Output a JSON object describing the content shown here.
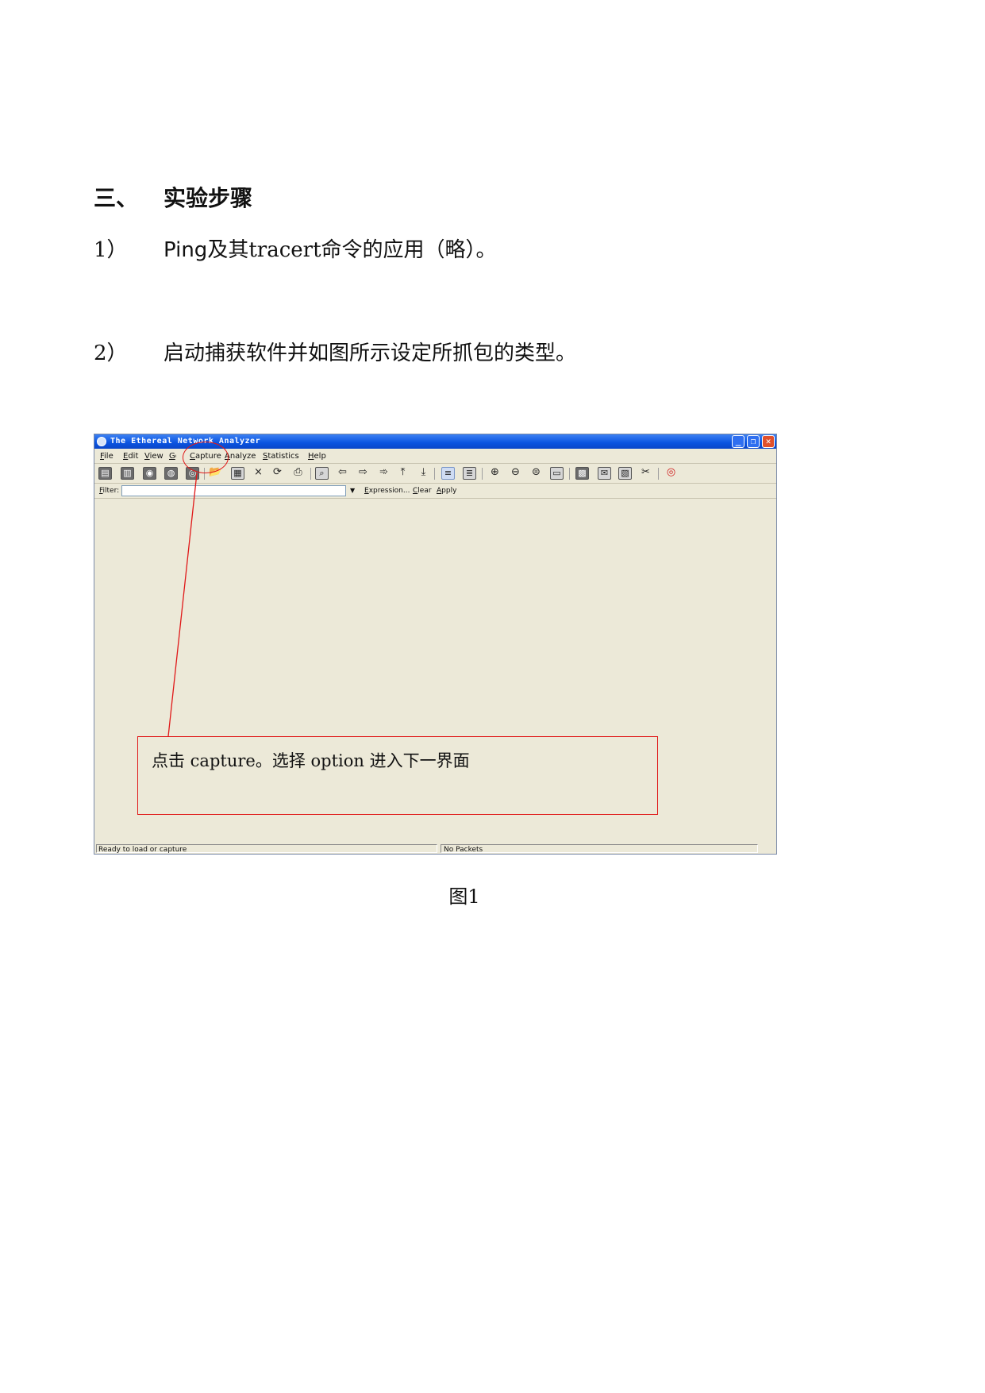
{
  "section_heading": {
    "number": "三、",
    "text": "实验步骤"
  },
  "steps": [
    {
      "number": "1）",
      "prefix": "Ping",
      "text": "及其tracert命令的应用（略）。"
    },
    {
      "number": "2）",
      "text": "启动捕获软件并如图所示设定所抓包的类型。"
    }
  ],
  "screenshot": {
    "window_title": "The Ethereal Network Analyzer",
    "menus": [
      "File",
      "Edit",
      "View",
      "Go",
      "Capture",
      "Analyze",
      "Statistics",
      "Help"
    ],
    "filter_label": "Filter:",
    "filter_value": "",
    "filter_buttons": {
      "expression": "Expression...",
      "clear": "Clear",
      "apply": "Apply"
    },
    "status_left": "Ready to load or capture",
    "status_right": "No Packets",
    "annotation": "点击 capture。选择 option 进入下一界面"
  },
  "caption": "图1"
}
